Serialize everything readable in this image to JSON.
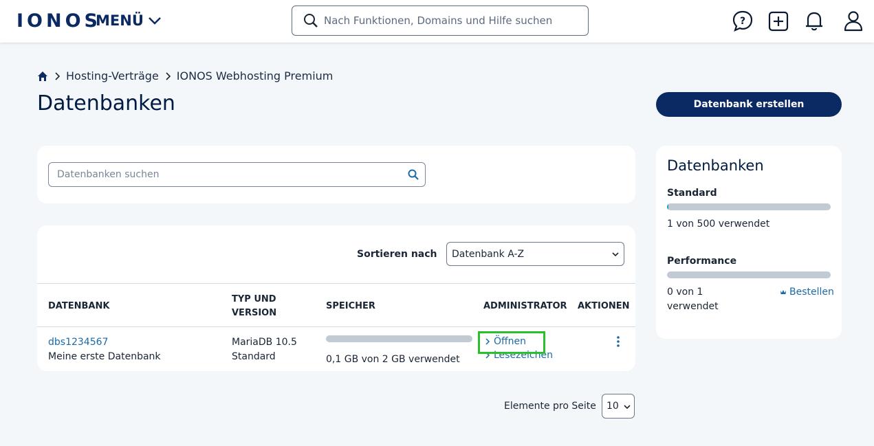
{
  "header": {
    "logo": "IONOS",
    "menu_label": "MENÜ",
    "search_placeholder": "Nach Funktionen, Domains und Hilfe suchen"
  },
  "breadcrumb": {
    "items": [
      "Hosting-Verträge",
      "IONOS Webhosting Premium"
    ]
  },
  "page": {
    "title": "Datenbanken",
    "create_button": "Datenbank erstellen"
  },
  "search": {
    "placeholder": "Datenbanken suchen"
  },
  "sort": {
    "label": "Sortieren nach",
    "selected": "Datenbank A-Z"
  },
  "table": {
    "headers": {
      "database": "DATENBANK",
      "type_line1": "TYP UND",
      "type_line2": "VERSION",
      "storage": "SPEICHER",
      "admin": "ADMINISTRATOR",
      "actions": "AKTIONEN"
    },
    "rows": [
      {
        "name": "dbs1234567",
        "description": "Meine erste Datenbank",
        "type": "MariaDB 10.5",
        "tier": "Standard",
        "storage_text": "0,1 GB von 2 GB verwendet",
        "storage_fraction": 0.05,
        "open_label": "Öffnen",
        "bookmark_label": "Lesezeichen"
      }
    ]
  },
  "pagination": {
    "label": "Elemente pro Seite",
    "per_page": "10"
  },
  "sidebar": {
    "title": "Datenbanken",
    "standard": {
      "label": "Standard",
      "usage_text": "1 von 500 verwendet",
      "fraction": 0.002
    },
    "performance": {
      "label": "Performance",
      "usage_line1": "0 von 1",
      "usage_line2": "verwendet",
      "fraction": 0,
      "order_label": "Bestellen"
    }
  },
  "colors": {
    "brand_navy": "#0b2a63",
    "link_blue": "#1b6aa8",
    "highlight_green": "#2bbf2b",
    "progress_fill": "#11a1c4",
    "progress_track": "#c2cad3",
    "page_bg": "#f4f7fa"
  },
  "icons": [
    "home-icon",
    "chevron-right-icon",
    "search-icon",
    "help-chat-icon",
    "add-icon",
    "bell-icon",
    "user-icon",
    "chevron-down-icon",
    "kebab-menu-icon",
    "crown-icon"
  ]
}
